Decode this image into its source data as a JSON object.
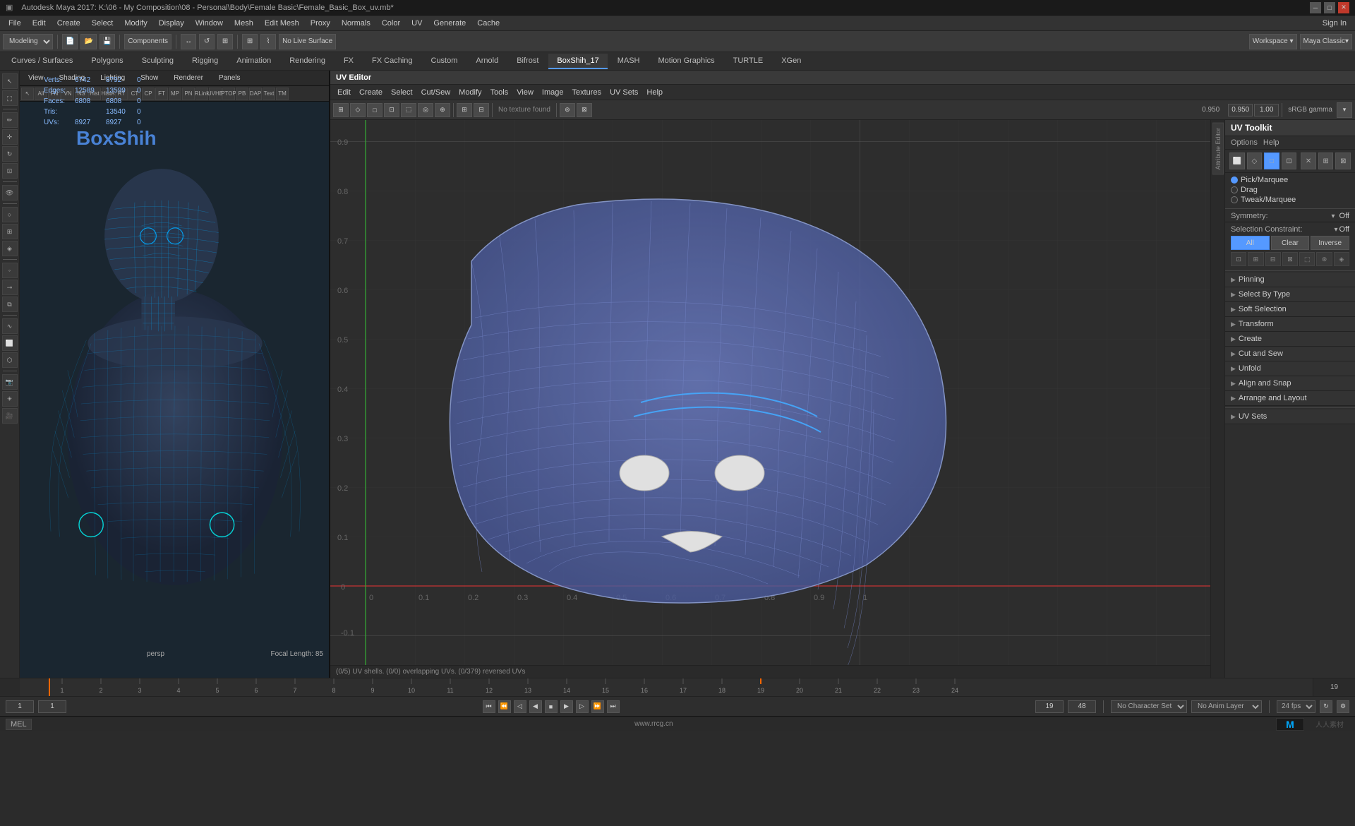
{
  "titleBar": {
    "title": "Autodesk Maya 2017: K:\\06 - My Composition\\08 - Personal\\Body\\Female Basic\\Female_Basic_Box_uv.mb*",
    "controls": [
      "minimize",
      "maximize",
      "close"
    ]
  },
  "menuBar": {
    "menus": [
      "File",
      "Edit",
      "Create",
      "Select",
      "Modify",
      "Display",
      "Window",
      "Mesh",
      "Edit Mesh",
      "Proxy",
      "Normals",
      "Color",
      "UV",
      "Generate"
    ]
  },
  "moduleDropdown": "Modeling",
  "tabBar": {
    "tabs": [
      "Curves / Surfaces",
      "Polygons",
      "Sculpting",
      "Rigging",
      "Animation",
      "Rendering",
      "FX",
      "FX Caching",
      "Custom",
      "Arnold",
      "Bifrost",
      "BoxShih_17",
      "MASH",
      "Motion Graphics",
      "TURTLE",
      "XGen"
    ]
  },
  "viewportControls": {
    "items": [
      "View",
      "Shading",
      "Lighting",
      "Show",
      "Renderer",
      "Panels"
    ]
  },
  "statsPanel": {
    "verts": {
      "label": "Verts:",
      "val1": "6742",
      "val2": "8792",
      "val3": "0"
    },
    "edges": {
      "label": "Edges:",
      "val1": "12589",
      "val2": "13599",
      "val3": "0"
    },
    "faces": {
      "label": "Faces:",
      "val1": "6808",
      "val2": "6808",
      "val3": "0"
    },
    "tris": {
      "label": "Tris:",
      "val1": "",
      "val2": "13540",
      "val3": "0"
    },
    "uvs": {
      "label": "UVs:",
      "val1": "8927",
      "val2": "8927",
      "val3": "0"
    }
  },
  "viewportLabel": "persp",
  "focalLength": {
    "label": "Focal Length:",
    "value": "85"
  },
  "uvEditor": {
    "title": "UV Editor",
    "menuItems": [
      "Edit",
      "Create",
      "Select",
      "Cut/Sew",
      "Modify",
      "Tools",
      "View",
      "Image",
      "Textures",
      "UV Sets",
      "Help"
    ],
    "textureLabel": "No texture found",
    "gammaLabel": "sRGB gamma",
    "gammaValue": "1.00",
    "coordinateValue": "0.950"
  },
  "uvToolkit": {
    "title": "UV Toolkit",
    "options": [
      "Options",
      "Help"
    ],
    "radioOptions": {
      "pickMarquee": "Pick/Marquee",
      "drag": "Drag",
      "tweakMarquee": "Tweak/Marquee"
    },
    "symmetry": {
      "label": "Symmetry:",
      "value": "Off"
    },
    "selectionConstraint": {
      "label": "Selection Constraint:",
      "value": "Off",
      "buttons": [
        "All",
        "Clear",
        "Inverse"
      ]
    },
    "sections": {
      "pinning": "Pinning",
      "selectByType": "Select By Type",
      "softSelection": "Soft Selection",
      "transform": "Transform",
      "create": "Create",
      "cutAndSew": "Cut and Sew",
      "unfold": "Unfold",
      "alignAndSnap": "Align and Snap",
      "arrangeAndLayout": "Arrange and Layout",
      "uvSets": "UV Sets"
    }
  },
  "timeline": {
    "startFrame": 1,
    "endFrame": 24,
    "currentFrame": 19,
    "ticks": [
      1,
      2,
      3,
      4,
      5,
      6,
      7,
      8,
      9,
      10,
      11,
      12,
      13,
      14,
      15,
      16,
      17,
      18,
      19,
      20,
      21,
      22,
      23,
      24
    ]
  },
  "playbackControls": {
    "currentFrame": "1",
    "startFrame": "1",
    "endFrame": "24",
    "currentFrame2": "19",
    "halfFrame": "48",
    "buttons": [
      "jump-start",
      "prev-frame",
      "prev-key",
      "play-back",
      "stop",
      "play-forward",
      "next-key",
      "next-frame",
      "jump-end"
    ]
  },
  "statusBar": {
    "mode": "MEL",
    "noCharacterSet": "No Character Set",
    "noAnimLayer": "No Anim Layer",
    "fps": "24 fps",
    "watermark": "www.rrcg.cn"
  },
  "uvStatus": "(0/5) UV shells. (0/0) overlapping UVs. (0/379) reversed UVs",
  "sidebarTools": [
    "select",
    "lasso",
    "paint",
    "move",
    "rotate",
    "scale",
    "mirror",
    "soft-mod",
    "lattice",
    "cluster"
  ],
  "boxShihLabel": "BoxShih"
}
